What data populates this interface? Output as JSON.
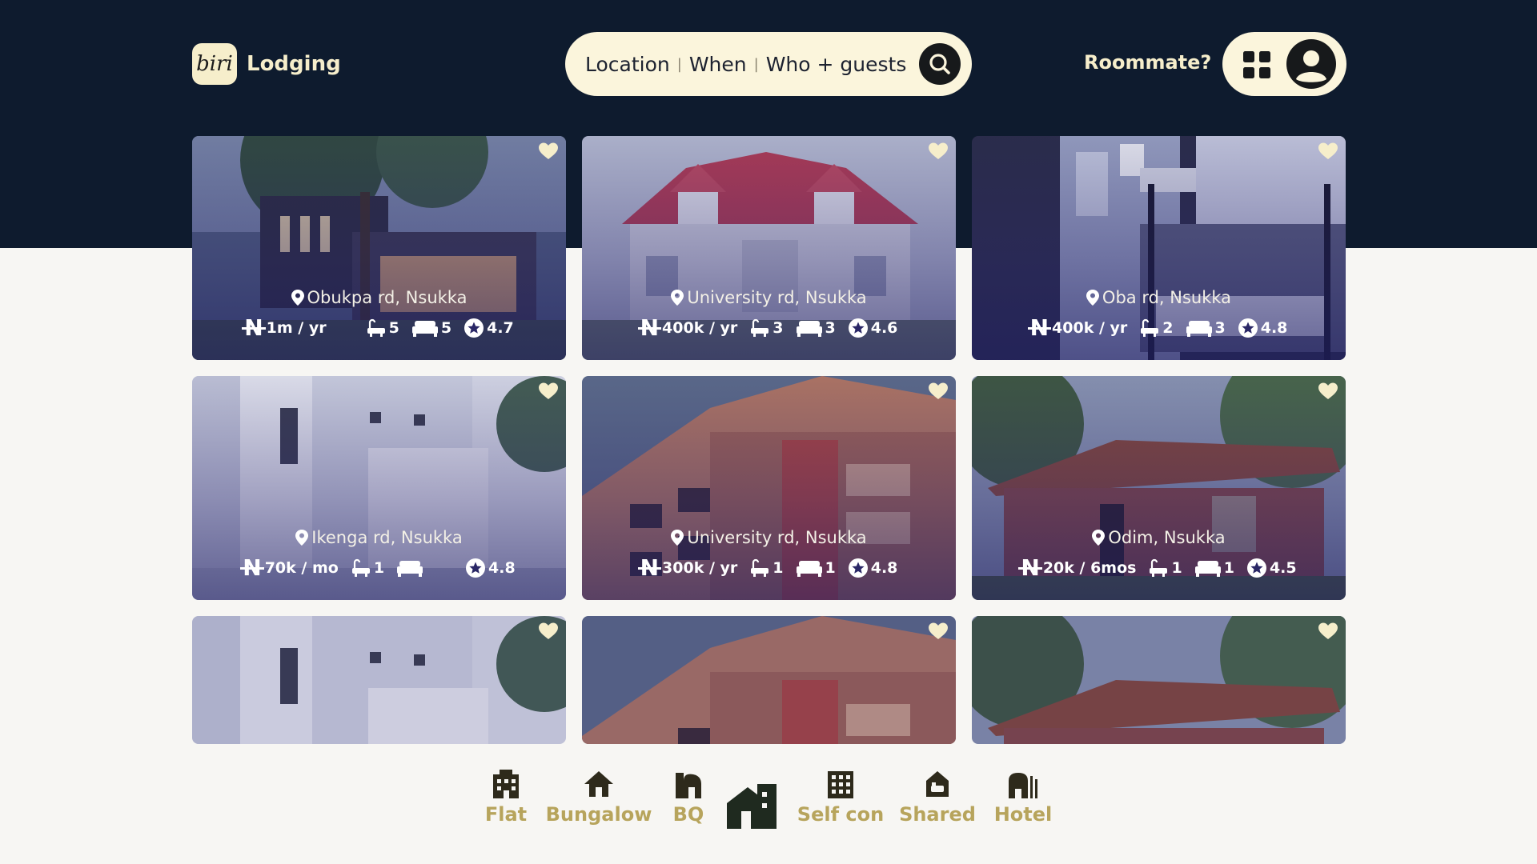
{
  "header": {
    "logo_text": "biri",
    "brand": "Lodging",
    "search": {
      "location": "Location",
      "when": "When",
      "who": "Who + guests"
    },
    "roommate": "Roommate?"
  },
  "colors": {
    "navy": "#0e1b2e",
    "cream": "#fbf5dc",
    "gold": "#b7a45c",
    "icon_dark": "#2e2a1b"
  },
  "listings": [
    {
      "location": "Obukpa rd, Nsukka",
      "price": "1m / yr",
      "baths": "5",
      "beds": "5",
      "rating": "4.7"
    },
    {
      "location": "University rd, Nsukka",
      "price": "400k / yr",
      "baths": "3",
      "beds": "3",
      "rating": "4.6"
    },
    {
      "location": "Oba rd, Nsukka",
      "price": "400k / yr",
      "baths": "2",
      "beds": "3",
      "rating": "4.8"
    },
    {
      "location": "Ikenga rd, Nsukka",
      "price": "70k / mo",
      "baths": "1",
      "beds": "",
      "rating": "4.8"
    },
    {
      "location": "University rd, Nsukka",
      "price": "300k / yr",
      "baths": "1",
      "beds": "1",
      "rating": "4.8"
    },
    {
      "location": "Odim, Nsukka",
      "price": "20k / 6mos",
      "baths": "1",
      "beds": "1",
      "rating": "4.5"
    }
  ],
  "categories": [
    {
      "label": "Flat",
      "icon": "building-icon"
    },
    {
      "label": "Bungalow",
      "icon": "house-icon"
    },
    {
      "label": "BQ",
      "icon": "bq-icon"
    },
    {
      "label": "Self con",
      "icon": "apartment-icon"
    },
    {
      "label": "Shared",
      "icon": "shared-icon"
    },
    {
      "label": "Hotel",
      "icon": "hotel-icon"
    }
  ]
}
